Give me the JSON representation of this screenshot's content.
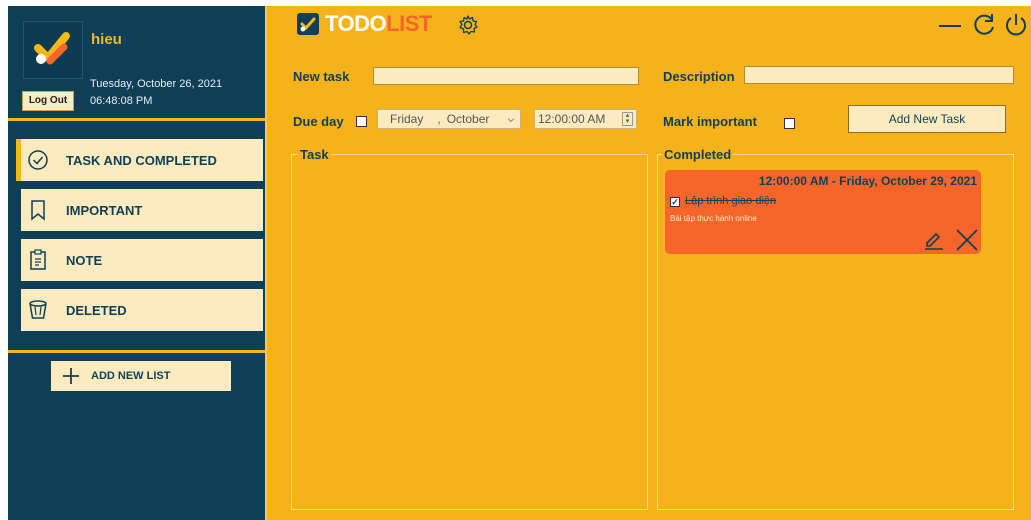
{
  "user": {
    "name": "hieu",
    "date": "Tuesday, October 26, 2021",
    "time": "06:48:08 PM",
    "logout_label": "Log Out"
  },
  "sidebar": {
    "items": [
      {
        "label": "TASK AND COMPLETED",
        "icon": "check-circle-icon",
        "active": true
      },
      {
        "label": "IMPORTANT",
        "icon": "bookmark-icon",
        "active": false
      },
      {
        "label": "NOTE",
        "icon": "clipboard-icon",
        "active": false
      },
      {
        "label": "DELETED",
        "icon": "trash-bin-icon",
        "active": false
      }
    ],
    "add_list_label": "ADD NEW LIST"
  },
  "header": {
    "logo_todo": "TODO",
    "logo_list": "LIST"
  },
  "form": {
    "new_task_label": "New task",
    "new_task_value": "",
    "description_label": "Description",
    "description_value": "",
    "due_day_label": "Due day",
    "due_day_checked": false,
    "date_day": "Friday",
    "date_sep": ",",
    "date_month": "October",
    "time_value": "12:00:00 AM",
    "mark_important_label": "Mark important",
    "mark_important_checked": false,
    "add_button_label": "Add New Task"
  },
  "panels": {
    "task_title": "Task",
    "completed_title": "Completed"
  },
  "completed_tasks": [
    {
      "datetime": "12:00:00 AM - Friday, October 29, 2021",
      "title": "Lập trình giao diện",
      "description": "Bài tập thực hành online",
      "checked": true
    }
  ],
  "colors": {
    "sidebar_bg": "#0e3f57",
    "main_bg": "#f5b21b",
    "accent": "#f5b81b",
    "card_bg": "#f6662a",
    "cream": "#fdebc0"
  }
}
